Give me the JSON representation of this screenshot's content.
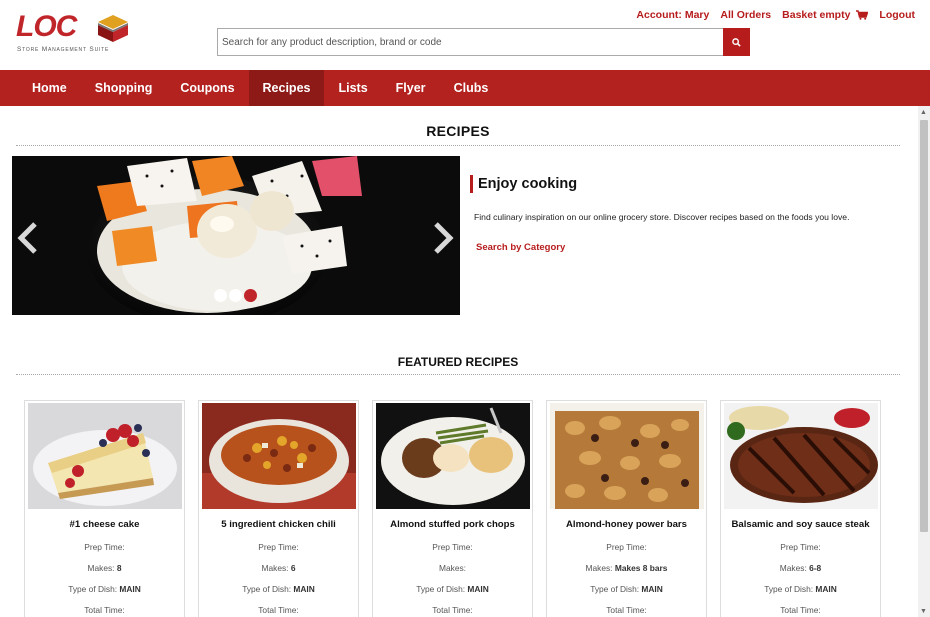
{
  "brand": {
    "logo_text": "LOC",
    "logo_sub": "Store Management Suite",
    "red": "#b4221f",
    "dark_red": "#8d1a17"
  },
  "search": {
    "placeholder": "Search for any product description, brand or code",
    "button_icon": "search-icon"
  },
  "toplinks": {
    "account": "Account: Mary",
    "orders": "All Orders",
    "basket": "Basket empty",
    "logout": "Logout"
  },
  "nav": {
    "items": [
      {
        "label": "Home"
      },
      {
        "label": "Shopping"
      },
      {
        "label": "Coupons"
      },
      {
        "label": "Recipes",
        "active": true
      },
      {
        "label": "Lists"
      },
      {
        "label": "Flyer"
      },
      {
        "label": "Clubs"
      }
    ]
  },
  "page": {
    "title": "RECIPES"
  },
  "intro": {
    "heading": "Enjoy cooking",
    "text": "Find culinary inspiration on our online grocery store. Discover recipes based on the foods you love.",
    "link": "Search by Category"
  },
  "carousel": {
    "slides": 3,
    "active_slide": 3
  },
  "featured": {
    "title": "FEATURED RECIPES",
    "labels": {
      "prep": "Prep Time:",
      "makes": "Makes:",
      "type": "Type of Dish:",
      "total": "Total Time:"
    },
    "cards": [
      {
        "title": "#1 cheese cake",
        "prep": "",
        "makes": "8",
        "type": "MAIN",
        "total": ""
      },
      {
        "title": "5 ingredient chicken chili",
        "prep": "",
        "makes": "6",
        "type": "MAIN",
        "total": ""
      },
      {
        "title": "Almond stuffed pork chops",
        "prep": "",
        "makes": "",
        "type": "MAIN",
        "total": ""
      },
      {
        "title": "Almond-honey power bars",
        "prep": "",
        "makes": "Makes 8 bars",
        "type": "MAIN",
        "total": ""
      },
      {
        "title": "Balsamic and soy sauce steak",
        "prep": "",
        "makes": "6-8",
        "type": "MAIN",
        "total": ""
      }
    ]
  }
}
